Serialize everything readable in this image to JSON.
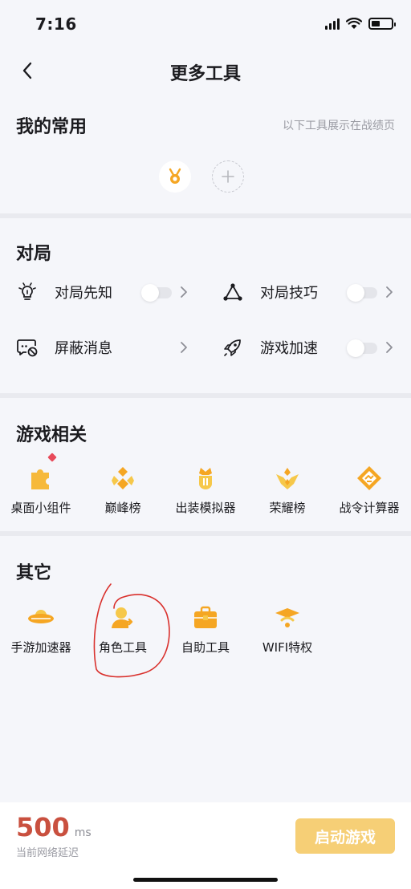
{
  "status_bar": {
    "time": "7:16"
  },
  "nav": {
    "title": "更多工具",
    "back_icon": "chevron-left-icon"
  },
  "favorites": {
    "title": "我的常用",
    "hint": "以下工具展示在战绩页",
    "slots": [
      {
        "icon": "medal-icon"
      },
      {
        "icon": "plus-icon"
      }
    ]
  },
  "match": {
    "title": "对局",
    "items": [
      {
        "label": "对局先知",
        "icon": "lightbulb-icon",
        "toggle": "off"
      },
      {
        "label": "对局技巧",
        "icon": "triangle-nodes-icon",
        "toggle": "off"
      },
      {
        "label": "屏蔽消息",
        "icon": "message-block-icon"
      },
      {
        "label": "游戏加速",
        "icon": "rocket-icon",
        "toggle": "off"
      }
    ]
  },
  "game": {
    "title": "游戏相关",
    "items": [
      {
        "label": "桌面小组件",
        "icon": "puzzle-icon",
        "badge": "red-dot"
      },
      {
        "label": "巅峰榜",
        "icon": "peak-rank-icon"
      },
      {
        "label": "出装模拟器",
        "icon": "equipment-icon"
      },
      {
        "label": "荣耀榜",
        "icon": "glory-rank-icon"
      },
      {
        "label": "战令计算器",
        "icon": "calculator-icon"
      }
    ]
  },
  "other": {
    "title": "其它",
    "items": [
      {
        "label": "手游加速器",
        "icon": "ufo-icon"
      },
      {
        "label": "角色工具",
        "icon": "role-icon"
      },
      {
        "label": "自助工具",
        "icon": "toolbox-icon"
      },
      {
        "label": "WIFI特权",
        "icon": "wifi-privilege-icon"
      }
    ]
  },
  "bottom": {
    "latency_value": "500",
    "latency_unit": "ms",
    "latency_label": "当前网络延迟",
    "start_button": "启动游戏"
  },
  "colors": {
    "accent_orange": "#f5a623",
    "accent_yellow": "#f6c84a",
    "latency_red": "#c9503f",
    "button_bg": "#f6cf76",
    "annotation_red": "#d9302c"
  }
}
